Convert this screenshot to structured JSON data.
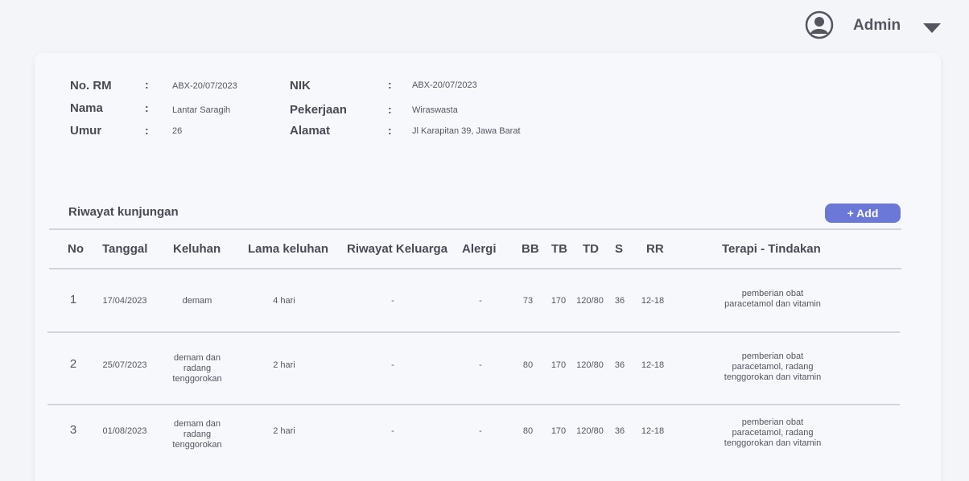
{
  "header": {
    "user_name": "Admin",
    "avatar_icon": "user-circle-icon",
    "dropdown_icon": "caret-down-icon"
  },
  "patient": {
    "no_rm_label": "No. RM",
    "no_rm_value": "ABX-20/07/2023",
    "nama_label": "Nama",
    "nama_value": "Lantar Saragih",
    "umur_label": "Umur",
    "umur_value": "26",
    "nik_label": "NIK",
    "nik_value": "ABX-20/07/2023",
    "pekerjaan_label": "Pekerjaan",
    "pekerjaan_value": "Wiraswasta",
    "alamat_label": "Alamat",
    "alamat_value": "Jl Karapitan 39, Jawa Barat",
    "separator": ":"
  },
  "visits": {
    "title": "Riwayat kunjungan",
    "add_label": "+ Add",
    "columns": [
      "No",
      "Tanggal",
      "Keluhan",
      "Lama keluhan",
      "Riwayat Keluarga",
      "Alergi",
      "BB",
      "TB",
      "TD",
      "S",
      "RR",
      "Terapi - Tindakan"
    ],
    "rows": [
      {
        "no": "1",
        "tanggal": "17/04/2023",
        "keluhan": "demam",
        "lama": "4 hari",
        "riwayat": "-",
        "alergi": "-",
        "bb": "73",
        "tb": "170",
        "td": "120/80",
        "s": "36",
        "rr": "12-18",
        "terapi": "pemberian obat paracetamol dan vitamin"
      },
      {
        "no": "2",
        "tanggal": "25/07/2023",
        "keluhan": "demam dan radang tenggorokan",
        "lama": "2 hari",
        "riwayat": "-",
        "alergi": "-",
        "bb": "80",
        "tb": "170",
        "td": "120/80",
        "s": "36",
        "rr": "12-18",
        "terapi": "pemberian obat paracetamol, radang tenggorokan dan vitamin"
      },
      {
        "no": "3",
        "tanggal": "01/08/2023",
        "keluhan": "demam dan radang tenggorokan",
        "lama": "2 hari",
        "riwayat": "-",
        "alergi": "-",
        "bb": "80",
        "tb": "170",
        "td": "120/80",
        "s": "36",
        "rr": "12-18",
        "terapi": "pemberian obat paracetamol, radang tenggorokan dan vitamin"
      }
    ]
  }
}
